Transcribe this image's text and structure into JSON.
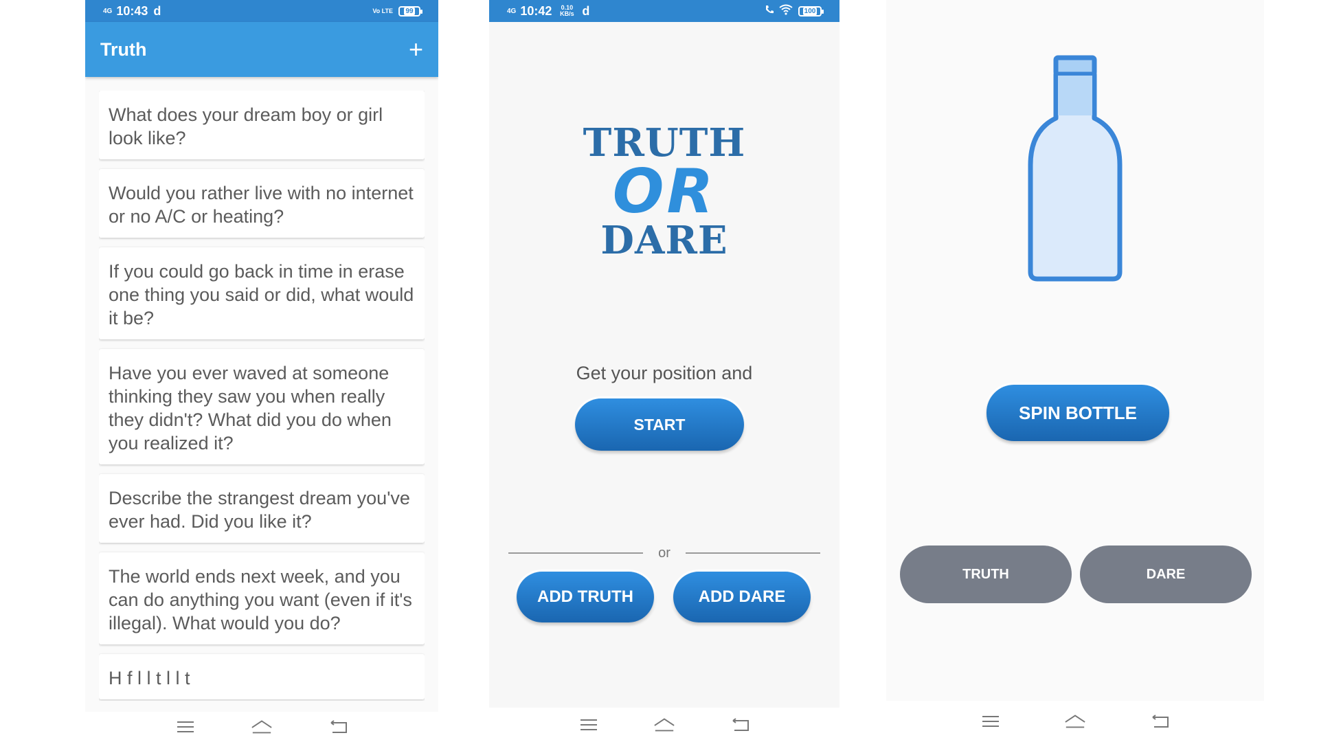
{
  "phone1": {
    "status": {
      "network": "4G",
      "time": "10:43",
      "carrier": "d",
      "volte": "Vo LTE",
      "battery": "99"
    },
    "appbar": {
      "title": "Truth",
      "add": "+"
    },
    "questions": [
      "What does your dream boy or girl look like?",
      "Would you rather live with no internet or no A/C or heating?",
      "If you could go back in time in erase one thing you said or did, what would it be?",
      "Have you ever waved at someone thinking they saw you when really they didn't? What did you do when you realized it?",
      "Describe the strangest dream you've ever had. Did you like it?",
      "The world ends next week, and you can do anything you want (even if it's illegal). What would you do?",
      "H  f         l  l              t    l    l  t"
    ]
  },
  "phone2": {
    "status": {
      "network": "4G",
      "time": "10:42",
      "speed": "0.10 KB/s",
      "carrier": "d",
      "battery": "100"
    },
    "logo": {
      "line1": "TRUTH",
      "line2": "OR",
      "line3": "DARE"
    },
    "tagline": "Get your position and",
    "start": "START",
    "or": "or",
    "add_truth": "ADD TRUTH",
    "add_dare": "ADD DARE"
  },
  "phone3": {
    "spin": "SPIN BOTTLE",
    "truth": "TRUTH",
    "dare": "DARE"
  },
  "icons": {
    "menu": "menu-icon",
    "home": "home-icon",
    "back": "back-icon",
    "bottle": "bottle-icon"
  }
}
